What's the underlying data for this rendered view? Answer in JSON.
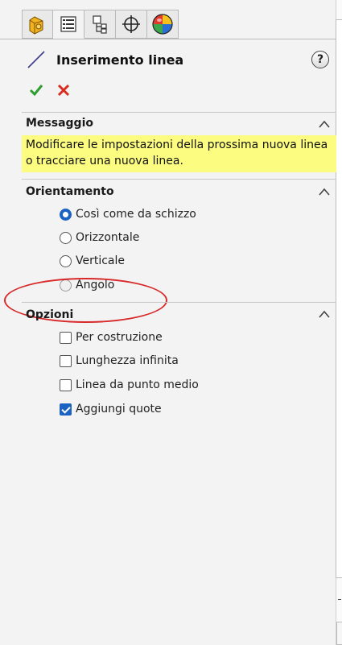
{
  "tabs": [
    {
      "icon": "feature-manager-icon"
    },
    {
      "icon": "property-manager-icon"
    },
    {
      "icon": "configuration-manager-icon"
    },
    {
      "icon": "dimxpert-manager-icon"
    },
    {
      "icon": "display-manager-icon"
    }
  ],
  "header": {
    "icon": "line-icon",
    "title": "Inserimento linea",
    "help_label": "?"
  },
  "actions": {
    "ok_icon": "checkmark-icon",
    "cancel_icon": "x-icon",
    "ok_color": "#2e9e2e",
    "cancel_color": "#d92b1e"
  },
  "messaggio": {
    "header": "Messaggio",
    "text": "Modificare le impostazioni della prossima nuova linea o tracciare una nuova linea.",
    "background": "#fcfc80"
  },
  "orientamento": {
    "header": "Orientamento",
    "options": [
      {
        "label": "Così come da schizzo",
        "checked": true
      },
      {
        "label": "Orizzontale",
        "checked": false
      },
      {
        "label": "Verticale",
        "checked": false
      },
      {
        "label": "Angolo",
        "checked": false
      }
    ]
  },
  "opzioni": {
    "header": "Opzioni",
    "options": [
      {
        "label": "Per costruzione",
        "checked": false
      },
      {
        "label": "Lunghezza infinita",
        "checked": false
      },
      {
        "label": "Linea da punto medio",
        "checked": false
      },
      {
        "label": "Aggiungi quote",
        "checked": true
      }
    ]
  },
  "accent_color": "#1a63c2",
  "annotation_color": "#d82a2a"
}
